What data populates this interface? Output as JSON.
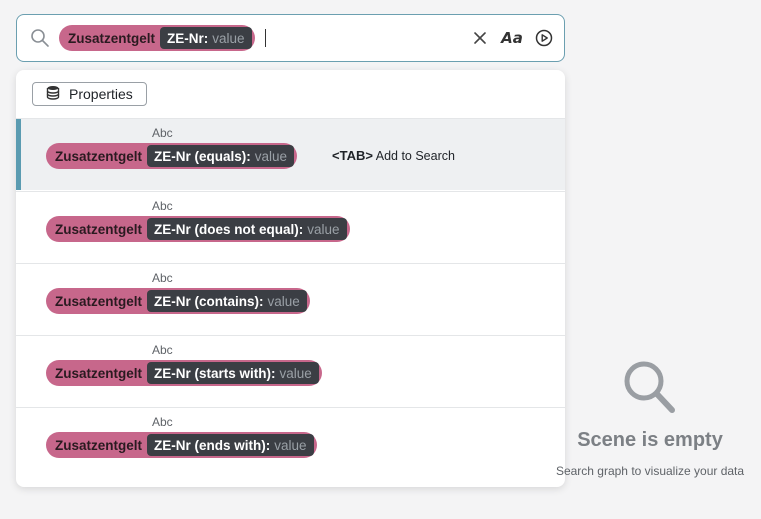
{
  "search": {
    "chip": {
      "entity": "Zusatzentgelt",
      "property": "ZE-Nr:",
      "value": "value"
    },
    "icons": {
      "search": "search-icon",
      "clear": "close-icon",
      "case": "match-case-icon",
      "run": "play-circle-icon"
    },
    "case_label": "Aa"
  },
  "dropdown": {
    "properties_label": "Properties",
    "hint_key": "<TAB>",
    "hint_text": "Add to Search",
    "suggestions": [
      {
        "type": "Abc",
        "entity": "Zusatzentgelt",
        "property": "ZE-Nr (equals):",
        "value": "value"
      },
      {
        "type": "Abc",
        "entity": "Zusatzentgelt",
        "property": "ZE-Nr (does not equal):",
        "value": "value"
      },
      {
        "type": "Abc",
        "entity": "Zusatzentgelt",
        "property": "ZE-Nr (contains):",
        "value": "value"
      },
      {
        "type": "Abc",
        "entity": "Zusatzentgelt",
        "property": "ZE-Nr (starts with):",
        "value": "value"
      },
      {
        "type": "Abc",
        "entity": "Zusatzentgelt",
        "property": "ZE-Nr (ends with):",
        "value": "value"
      }
    ]
  },
  "empty_state": {
    "title": "Scene is empty",
    "subtitle": "Search graph to visualize your data"
  },
  "colors": {
    "chip": "#c7678b",
    "property_tag": "#3b3e44",
    "accent": "#5a9bb1"
  }
}
